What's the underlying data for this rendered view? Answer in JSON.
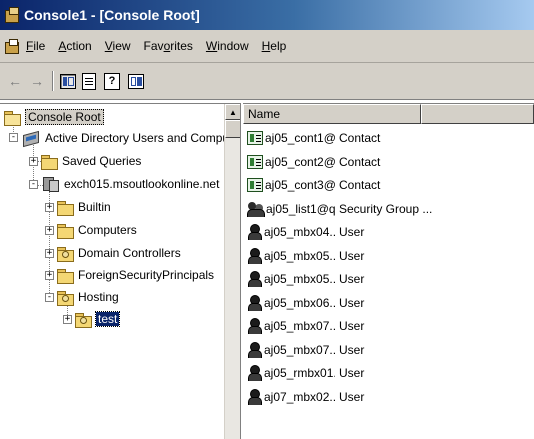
{
  "window": {
    "title": "Console1 - [Console Root]"
  },
  "menu": {
    "items": [
      {
        "pre": "",
        "ul": "F",
        "post": "ile"
      },
      {
        "pre": "",
        "ul": "A",
        "post": "ction"
      },
      {
        "pre": "",
        "ul": "V",
        "post": "iew"
      },
      {
        "pre": "Fav",
        "ul": "o",
        "post": "rites"
      },
      {
        "pre": "",
        "ul": "W",
        "post": "indow"
      },
      {
        "pre": "",
        "ul": "H",
        "post": "elp"
      }
    ]
  },
  "toolbar": {
    "icons": [
      "back-arrow-icon",
      "forward-arrow-icon",
      "show-hide-tree-icon",
      "export-list-icon",
      "help-icon",
      "show-hide-action-pane-icon"
    ]
  },
  "tree": {
    "root": "Console Root",
    "ad": "Active Directory Users and Computers [DC",
    "saved_queries": "Saved Queries",
    "domain": "exch015.msoutlookonline.net",
    "builtin": "Builtin",
    "computers": "Computers",
    "domain_controllers": "Domain Controllers",
    "foreign": "ForeignSecurityPrincipals",
    "hosting": "Hosting",
    "test": "test"
  },
  "list": {
    "columns": {
      "name": "Name",
      "type": ""
    },
    "rows": [
      {
        "icon": "contact",
        "name": "aj05_cont1@...",
        "type": "Contact"
      },
      {
        "icon": "contact",
        "name": "aj05_cont2@...",
        "type": "Contact"
      },
      {
        "icon": "contact",
        "name": "aj05_cont3@...",
        "type": "Contact"
      },
      {
        "icon": "group",
        "name": "aj05_list1@q...",
        "type": "Security Group ..."
      },
      {
        "icon": "user",
        "name": "aj05_mbx04...",
        "type": "User"
      },
      {
        "icon": "user",
        "name": "aj05_mbx05...",
        "type": "User"
      },
      {
        "icon": "user",
        "name": "aj05_mbx05...",
        "type": "User"
      },
      {
        "icon": "user",
        "name": "aj05_mbx06...",
        "type": "User"
      },
      {
        "icon": "user",
        "name": "aj05_mbx07...",
        "type": "User"
      },
      {
        "icon": "user",
        "name": "aj05_mbx07...",
        "type": "User"
      },
      {
        "icon": "user",
        "name": "aj05_rmbx01...",
        "type": "User"
      },
      {
        "icon": "user",
        "name": "aj07_mbx02...",
        "type": "User"
      }
    ]
  }
}
